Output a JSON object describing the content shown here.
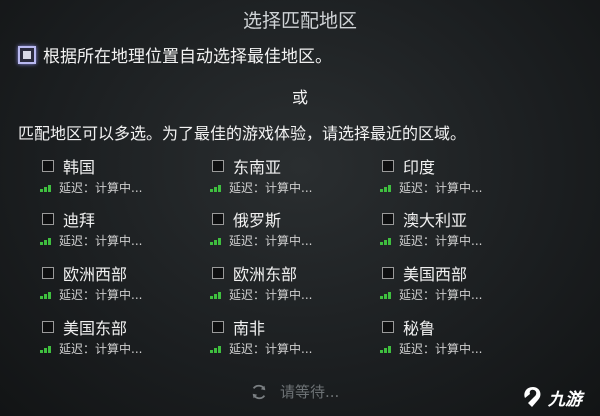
{
  "title": "选择匹配地区",
  "auto_select": {
    "label": "根据所在地理位置自动选择最佳地区。",
    "checked": true
  },
  "or_text": "或",
  "description": "匹配地区可以多选。为了最佳的游戏体验，请选择最近的区域。",
  "regions": [
    {
      "name": "韩国",
      "latency": "延迟：计算中..."
    },
    {
      "name": "东南亚",
      "latency": "延迟：计算中..."
    },
    {
      "name": "印度",
      "latency": "延迟：计算中..."
    },
    {
      "name": "迪拜",
      "latency": "延迟：计算中..."
    },
    {
      "name": "俄罗斯",
      "latency": "延迟：计算中..."
    },
    {
      "name": "澳大利亚",
      "latency": "延迟：计算中..."
    },
    {
      "name": "欧洲西部",
      "latency": "延迟：计算中..."
    },
    {
      "name": "欧洲东部",
      "latency": "延迟：计算中..."
    },
    {
      "name": "美国西部",
      "latency": "延迟：计算中..."
    },
    {
      "name": "美国东部",
      "latency": "延迟：计算中..."
    },
    {
      "name": "南非",
      "latency": "延迟：计算中..."
    },
    {
      "name": "秘鲁",
      "latency": "延迟：计算中..."
    }
  ],
  "status": {
    "text": "请等待..."
  },
  "watermark": {
    "text": "九游"
  },
  "colors": {
    "signal": "#3fbf3f",
    "checkbox_focus": "#b9b9f0"
  }
}
